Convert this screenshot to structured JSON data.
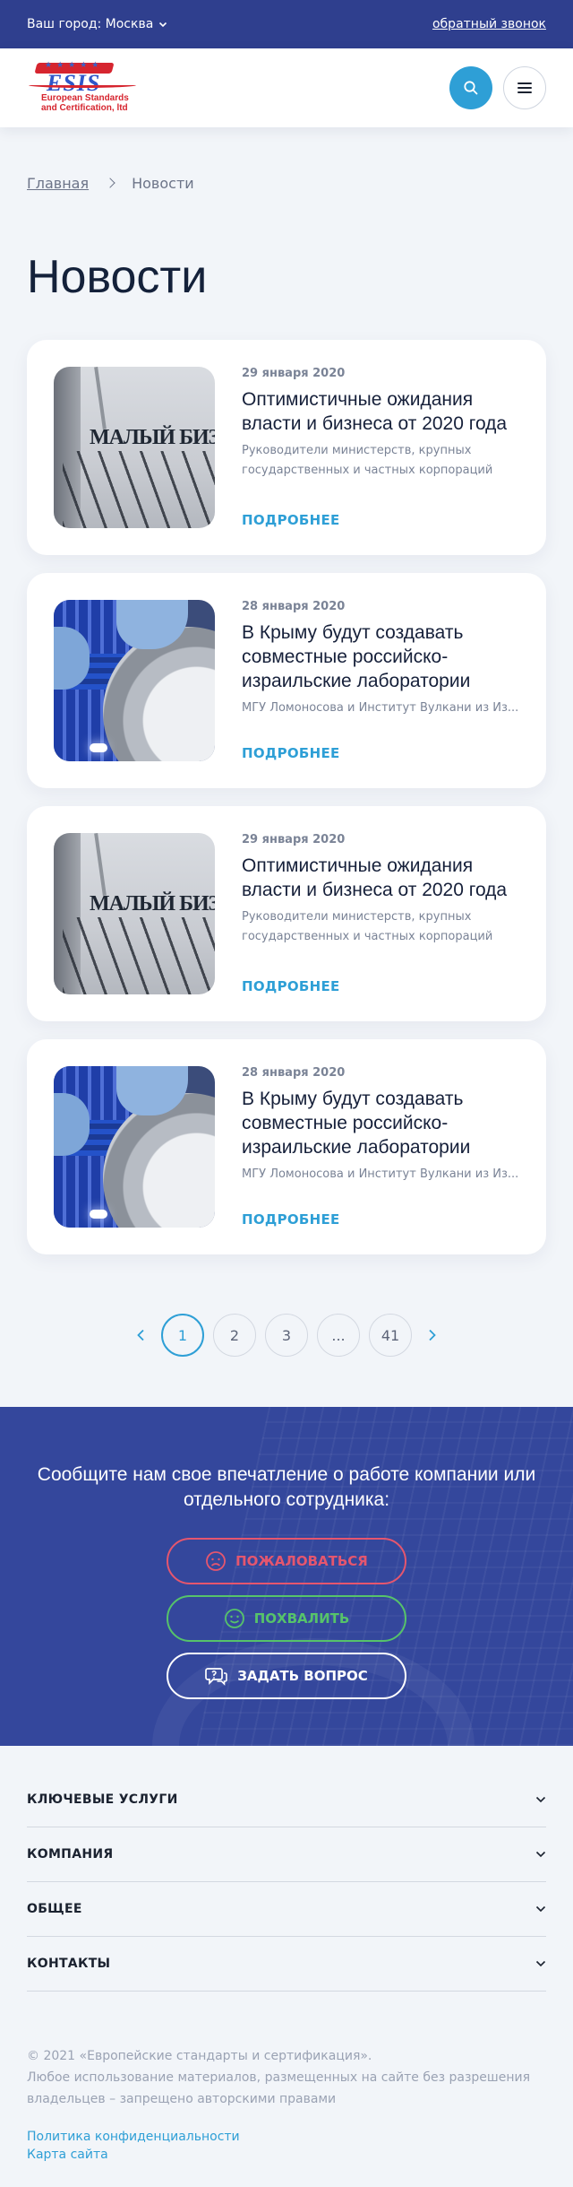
{
  "topbar": {
    "city_label": "Ваш город: Москва",
    "callback_label": "обратный звонок"
  },
  "header": {
    "logo": {
      "mark": "ESIS",
      "stars": "★★★★★",
      "line1": "European Standards",
      "line2": "and Certification, ltd"
    }
  },
  "breadcrumb": {
    "home": "Главная",
    "current": "Новости"
  },
  "page_title": "Новости",
  "news": [
    {
      "date": "29 января 2020",
      "title": "Оптимистичные ожидания власти и бизнеса от 2020 года",
      "excerpt": "Руководители министерств, крупных государственных и частных корпораций ра...",
      "more": "ПОДРОБНЕЕ",
      "image": "small-business-image",
      "image_text": "МАЛЫЙ БИЗНЕС"
    },
    {
      "date": "28 января 2020",
      "title": "В Крыму будут создавать совместные российско-израильские лаборатории",
      "excerpt": "МГУ Ломоносова и Институт Вулкани из Из...",
      "more": "ПОДРОБНЕЕ",
      "image": "laboratory-image"
    },
    {
      "date": "29 января 2020",
      "title": "Оптимистичные ожидания власти и бизнеса от 2020 года",
      "excerpt": "Руководители министерств, крупных государственных и частных корпораций ра...",
      "more": "ПОДРОБНЕЕ",
      "image": "small-business-image",
      "image_text": "МАЛЫЙ БИЗНЕС"
    },
    {
      "date": "28 января 2020",
      "title": "В Крыму будут создавать совместные российско-израильские лаборатории",
      "excerpt": "МГУ Ломоносова и Институт Вулкани из Из...",
      "more": "ПОДРОБНЕЕ",
      "image": "laboratory-image"
    }
  ],
  "pagination": {
    "pages": [
      "1",
      "2",
      "3",
      "...",
      "41"
    ],
    "current": "1"
  },
  "feedback": {
    "title": "Сообщите нам свое впечатление о работе компании или отдельного сотрудника:",
    "complain_label": "ПОЖАЛОВАТЬСЯ",
    "praise_label": "ПОХВАЛИТЬ",
    "ask_label": "ЗАДАТЬ ВОПРОС"
  },
  "footer": {
    "sections": [
      "КЛЮЧЕВЫЕ УСЛУГИ",
      "КОМПАНИЯ",
      "ОБЩЕЕ",
      "КОНТАКТЫ"
    ],
    "copyright_line1": "© 2021 «Европейские стандарты и сертификация».",
    "copyright_line2": "Любое использование материалов, размещенных на сайте без разрешения владельцев – запрещено авторскими правами",
    "privacy_label": "Политика конфиденциальности",
    "sitemap_label": "Карта сайта"
  },
  "colors": {
    "topbar": "#2f3f8e",
    "accent": "#2e9fd6",
    "complain": "#e5566e",
    "praise": "#56c36a",
    "feedback_bg": "#34479c"
  }
}
